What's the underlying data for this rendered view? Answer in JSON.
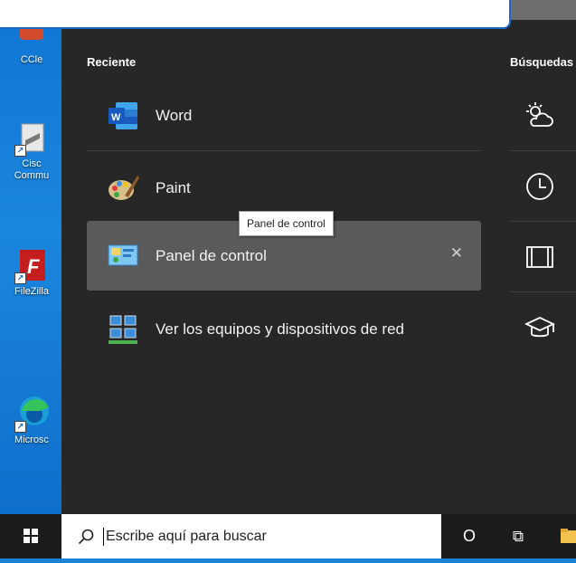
{
  "desktop": {
    "icons": [
      {
        "label": "CCle"
      },
      {
        "label": "Cisc\nCommu"
      },
      {
        "label": "FileZilla"
      },
      {
        "label": "Microsc"
      }
    ]
  },
  "start_menu": {
    "recent_title": "Reciente",
    "search_title": "Búsquedas",
    "recent_items": [
      {
        "label": "Word",
        "icon": "word-icon"
      },
      {
        "label": "Paint",
        "icon": "paint-icon"
      },
      {
        "label": "Panel de control",
        "icon": "control-panel-icon",
        "selected": true
      },
      {
        "label": "Ver los equipos y dispositivos de red",
        "icon": "network-icon"
      }
    ],
    "tooltip": "Panel de control",
    "remove_glyph": "✕",
    "search_icons": [
      "weather-icon",
      "clock-icon",
      "film-icon",
      "graduation-cap-icon"
    ]
  },
  "taskbar": {
    "search_placeholder": "Escribe aquí para buscar",
    "cortana_glyph": "O",
    "taskview_glyph": "⧉"
  },
  "colors": {
    "panel_bg": "#272727",
    "selected_bg": "#5a5a5a",
    "taskbar_bg": "#1c1c1c",
    "desktop_bg": "#1a82d8"
  }
}
